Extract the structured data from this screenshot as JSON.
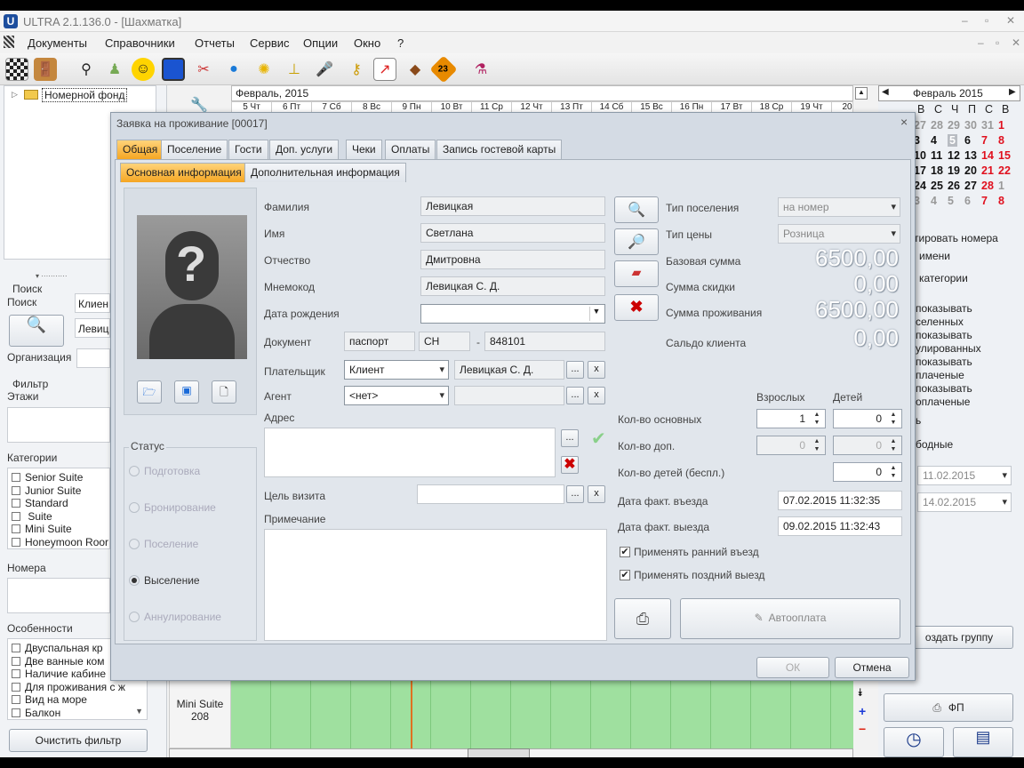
{
  "app": {
    "title": "ULTRA 2.1.136.0 - [Шахматка]",
    "logo": "U"
  },
  "menu": [
    "Документы",
    "Справочники",
    "Отчеты",
    "Сервис",
    "Опции",
    "Окно",
    "?"
  ],
  "toolbar_icons": [
    "chessboard-icon",
    "door-icon",
    "hanger-icon",
    "user-icon",
    "smiley-icon",
    "monitor-icon",
    "tools-icon",
    "pills-icon",
    "coin-icon",
    "ironing-icon",
    "microphone-icon",
    "keys-icon",
    "chart-icon",
    "piano-icon",
    "calendar-23-icon",
    "chemistry-icon"
  ],
  "toolbar_badge": "23",
  "left": {
    "tree_item": "Номерной фонд",
    "search_group": "Поиск",
    "search_label": "Поиск",
    "search_value1": "Клиен",
    "search_value2": "Левиц",
    "org_label": "Организация",
    "filter_group": "Фильтр",
    "floors_label": "Этажи",
    "categories_label": "Категории",
    "categories": [
      "Senior Suite",
      "Junior Suite",
      "Standard",
      " Suite",
      "Mini Suite",
      "Honeymoon Roor"
    ],
    "rooms_label": "Номера",
    "features_label": "Особенности",
    "features": [
      "Двуспальная кр",
      "Две ванные ком",
      "Наличие кабине",
      "Для проживания с ж",
      "Вид на море",
      "Балкон"
    ],
    "clear_filter": "Очистить фильтр"
  },
  "center": {
    "month": "Февраль, 2015",
    "days": [
      "5 Чт",
      "6 Пт",
      "7 Сб",
      "8 Вс",
      "9 Пн",
      "10 Вт",
      "11 Ср",
      "12 Чт",
      "13 Пт",
      "14 Сб",
      "15 Вс",
      "16 Пн",
      "17 Вт",
      "18 Ср",
      "19 Чт",
      "20 П"
    ],
    "room_cat": "Mini Suite",
    "room_num": "208"
  },
  "right": {
    "cal_month": "Февраль 2015",
    "cal_head": [
      "В",
      "С",
      "Ч",
      "П",
      "С",
      "В"
    ],
    "cal_rows": [
      [
        "27",
        "28",
        "29",
        "30",
        "31",
        "1"
      ],
      [
        "3",
        "4",
        "5",
        "6",
        "7",
        "8"
      ],
      [
        "10",
        "11",
        "12",
        "13",
        "14",
        "15"
      ],
      [
        "17",
        "18",
        "19",
        "20",
        "21",
        "22"
      ],
      [
        "24",
        "25",
        "26",
        "27",
        "28",
        "1"
      ],
      [
        "3",
        "4",
        "5",
        "6",
        "7",
        "8"
      ]
    ],
    "opt1": "тировать номера",
    "opt2": "имени",
    "opt3": "категории",
    "show_lines": [
      "показывать",
      "селенных",
      "показывать",
      "улированных",
      "показывать",
      "плаченые",
      "показывать",
      "оплаченые"
    ],
    "free1": "ь",
    "free2": "бодные",
    "date1": "11.02.2015",
    "date2": "14.02.2015",
    "create_group": "оздать группу",
    "fp": "ФП"
  },
  "dialog": {
    "title": "Заявка на проживание [00017]",
    "tabs": [
      "Общая",
      "Поселение",
      "Гости",
      "Доп. услуги",
      "Чеки",
      "Оплаты",
      "Запись гостевой карты"
    ],
    "subtabs": [
      "Основная информация",
      "Дополнительная информация"
    ],
    "lastname_label": "Фамилия",
    "lastname": "Левицкая",
    "firstname_label": "Имя",
    "firstname": "Светлана",
    "patronymic_label": "Отчество",
    "patronymic": "Дмитровна",
    "mnemo_label": "Мнемокод",
    "mnemo": "Левицкая С. Д.",
    "birth_label": "Дата рождения",
    "birth": "",
    "doc_label": "Документ",
    "doc_type": "паспорт",
    "doc_series": "СН",
    "doc_dash": "-",
    "doc_number": "848101",
    "payer_label": "Плательщик",
    "payer_type": "Клиент",
    "payer_name": "Левицкая С. Д.",
    "agent_label": "Агент",
    "agent": "<нет>",
    "address_label": "Адрес",
    "purpose_label": "Цель визита",
    "note_label": "Примечание",
    "status_label": "Статус",
    "statuses": [
      "Подготовка",
      "Бронирование",
      "Поселение",
      "Выселение",
      "Аннулирование"
    ],
    "status_selected": 3,
    "placement_type_label": "Тип поселения",
    "placement_type": "на номер",
    "price_type_label": "Тип цены",
    "price_type": "Розница",
    "base_sum_label": "Базовая сумма",
    "base_sum": "6500,00",
    "discount_label": "Сумма скидки",
    "discount": "0,00",
    "stay_sum_label": "Сумма проживания",
    "stay_sum": "6500,00",
    "balance_label": "Сальдо клиента",
    "balance": "0,00",
    "adults_head": "Взрослых",
    "children_head": "Детей",
    "main_count_label": "Кол-во основных",
    "main_adults": "1",
    "main_children": "0",
    "extra_count_label": "Кол-во доп.",
    "extra_adults": "0",
    "extra_children": "0",
    "free_children_label": "Кол-во детей (беспл.)",
    "free_children": "0",
    "checkin_label": "Дата факт. въезда",
    "checkin": "07.02.2015 11:32:35",
    "checkout_label": "Дата факт. выезда",
    "checkout": "09.02.2015 11:32:43",
    "early_label": "Применять ранний въезд",
    "late_label": "Применять поздний выезд",
    "autopay": "Автооплата",
    "ok": "ОК",
    "cancel": "Отмена",
    "ellipsis": "...",
    "x": "x"
  },
  "colors": {
    "accent_tab": "#f5a623",
    "grid_green": "#9fe09f",
    "cal_red": "#e0101e",
    "titlebar": "#d4dbe4"
  }
}
